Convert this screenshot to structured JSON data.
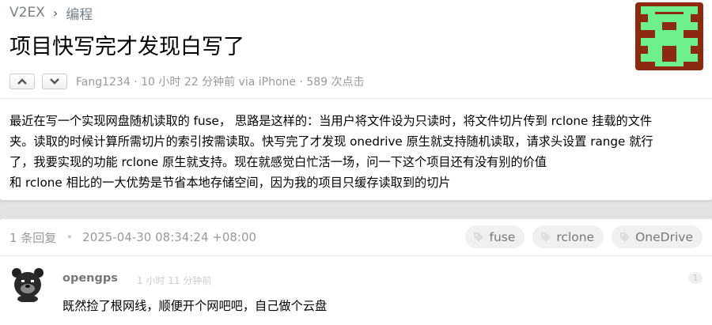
{
  "breadcrumb": {
    "site": "V2EX",
    "separator": "›",
    "node": "编程"
  },
  "topic": {
    "title": "项目快写完才发现白写了",
    "author": "Fang1234",
    "meta_suffix": " · 10 小时 22 分钟前 via iPhone · 589 次点击",
    "content_lines": [
      "最近在写一个实现网盘随机读取的 fuse，  思路是这样的：当用户将文件设为只读时，将文件切片传到 rclone 挂载的文件",
      "夹。读取的时候计算所需切片的索引按需读取。快写完了才发现 onedrive 原生就支持随机读取，请求头设置 range 就行",
      "了，我要实现的功能 rclone 原生就支持。现在就感觉白忙活一场，问一下这个项目还有没有别的价值",
      "和 rclone 相比的一大优势是节省本地存储空间，因为我的项目只缓存读取到的切片"
    ]
  },
  "replies_header": {
    "count_text": "1 条回复",
    "timestamp": "2025-04-30 08:34:24 +08:00"
  },
  "tags": [
    "fuse",
    "rclone",
    "OneDrive"
  ],
  "reply": {
    "author": "opengps",
    "time": "1 小时 11 分钟前",
    "number": "1",
    "content": "既然捡了根网线，顺便开个网吧吧，自己做个云盘"
  },
  "colors": {
    "avatar_bg": "#8b2a10",
    "avatar_fg": "#6ef08a",
    "muted": "#999999",
    "link": "#778087"
  },
  "icons": {
    "upvote": "chevron-up-icon",
    "downvote": "chevron-down-icon",
    "tag": "tag-icon"
  }
}
